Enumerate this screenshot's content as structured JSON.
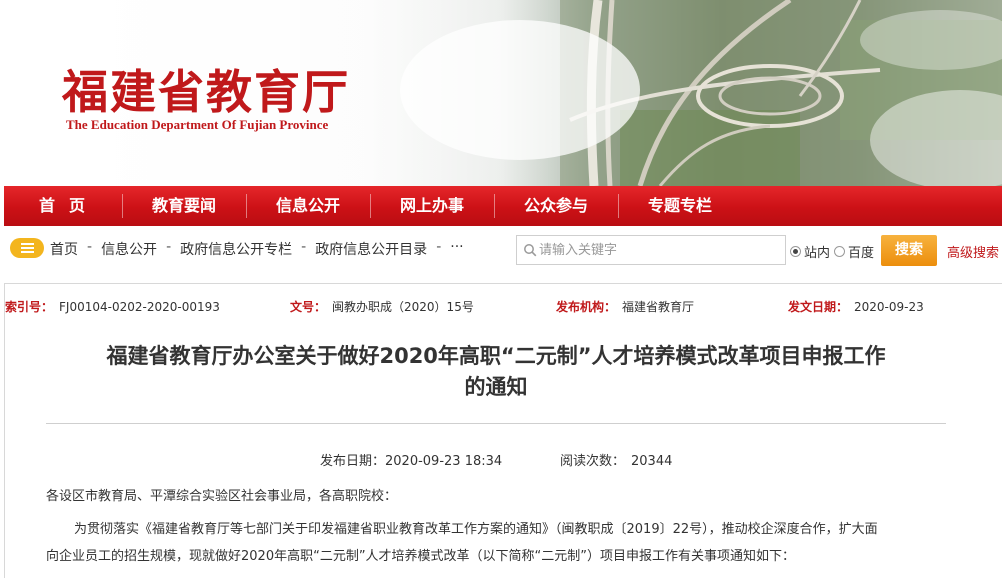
{
  "header": {
    "title_cn": "福建省教育厅",
    "title_en": "The Education Department Of Fujian Province"
  },
  "nav": {
    "items": [
      {
        "label": "首页"
      },
      {
        "label": "教育要闻"
      },
      {
        "label": "信息公开"
      },
      {
        "label": "网上办事"
      },
      {
        "label": "公众参与"
      },
      {
        "label": "专题专栏"
      }
    ]
  },
  "breadcrumb": {
    "items": [
      "首页",
      "信息公开",
      "政府信息公开专栏",
      "政府信息公开目录"
    ],
    "separator": "-",
    "more": "···"
  },
  "search": {
    "placeholder": "请输入关键字",
    "scope_site": "站内",
    "scope_baidu": "百度",
    "selected_scope": "站内",
    "button": "搜索",
    "advanced": "高级搜索"
  },
  "meta": {
    "index_label": "索引号：",
    "index_value": "FJ00104-0202-2020-00193",
    "docno_label": "文号：",
    "docno_value": "闽教办职成（2020）15号",
    "publisher_label": "发布机构：",
    "publisher_value": "福建省教育厅",
    "date_label": "发文日期：",
    "date_value": "2020-09-23"
  },
  "article": {
    "title_line1": "福建省教育厅办公室关于做好2020年高职“二元制”人才培养模式改革项目申报工作",
    "title_line2": "的通知",
    "published_label": "发布日期：",
    "published_value": "2020-09-23 18:34",
    "views_label": "阅读次数：",
    "views_value": "20344",
    "salutation": "各设区市教育局、平潭综合实验区社会事业局，各高职院校：",
    "body_line1": "为贯彻落实《福建省教育厅等七部门关于印发福建省职业教育改革工作方案的通知》（闽教职成〔2019〕22号），推动校企深度合作，扩大面",
    "body_line2": "向企业员工的招生规模，现就做好2020年高职“二元制”人才培养模式改革（以下简称“二元制”）项目申报工作有关事项通知如下："
  },
  "colors": {
    "brand_red": "#c0191b",
    "nav_red": "#cc1116",
    "search_orange": "#ec8e0c",
    "menu_yellow": "#f3b51e"
  }
}
